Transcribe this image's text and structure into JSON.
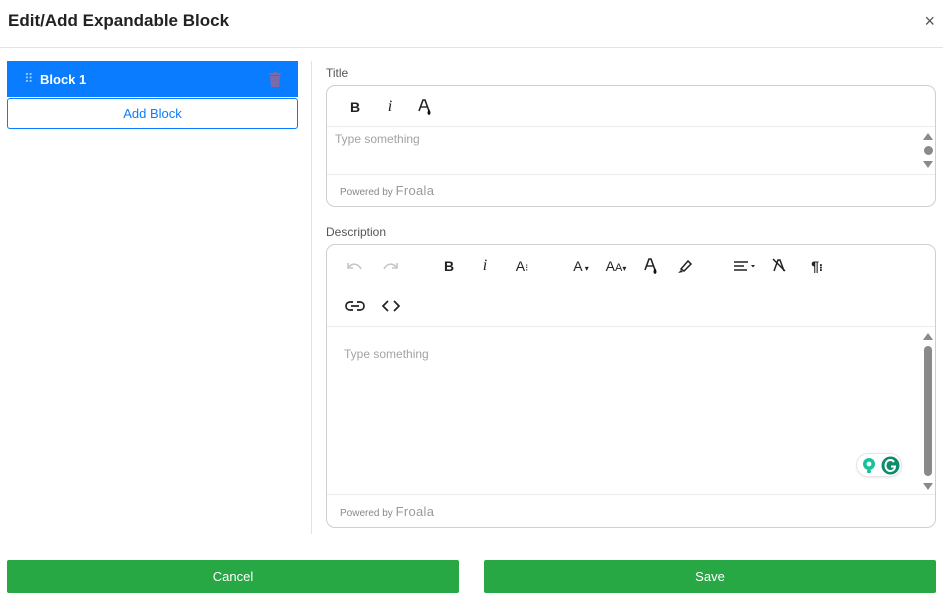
{
  "header": {
    "title": "Edit/Add Expandable Block",
    "close_label": "×"
  },
  "blocks": {
    "items": [
      {
        "label": "Block 1"
      }
    ],
    "add_label": "Add Block"
  },
  "title_field": {
    "label": "Title",
    "placeholder": "Type something",
    "toolbar": [
      "bold-icon",
      "italic-icon",
      "text-color-icon"
    ],
    "powered_by": "Powered by",
    "brand": "Froala"
  },
  "description_field": {
    "label": "Description",
    "placeholder": "Type something",
    "toolbar_row1": [
      "undo-icon",
      "redo-icon",
      "bold-icon",
      "italic-icon",
      "font-size-icon",
      "font-family-icon",
      "text-case-icon",
      "text-color-icon",
      "highlight-icon",
      "align-icon",
      "clear-format-icon",
      "paragraph-format-icon"
    ],
    "toolbar_row2": [
      "link-icon",
      "code-view-icon"
    ],
    "powered_by": "Powered by",
    "brand": "Froala"
  },
  "footer": {
    "cancel_label": "Cancel",
    "save_label": "Save"
  },
  "colors": {
    "primary": "#0a7cff",
    "success": "#28a745",
    "trash": "#7b6ba8"
  }
}
